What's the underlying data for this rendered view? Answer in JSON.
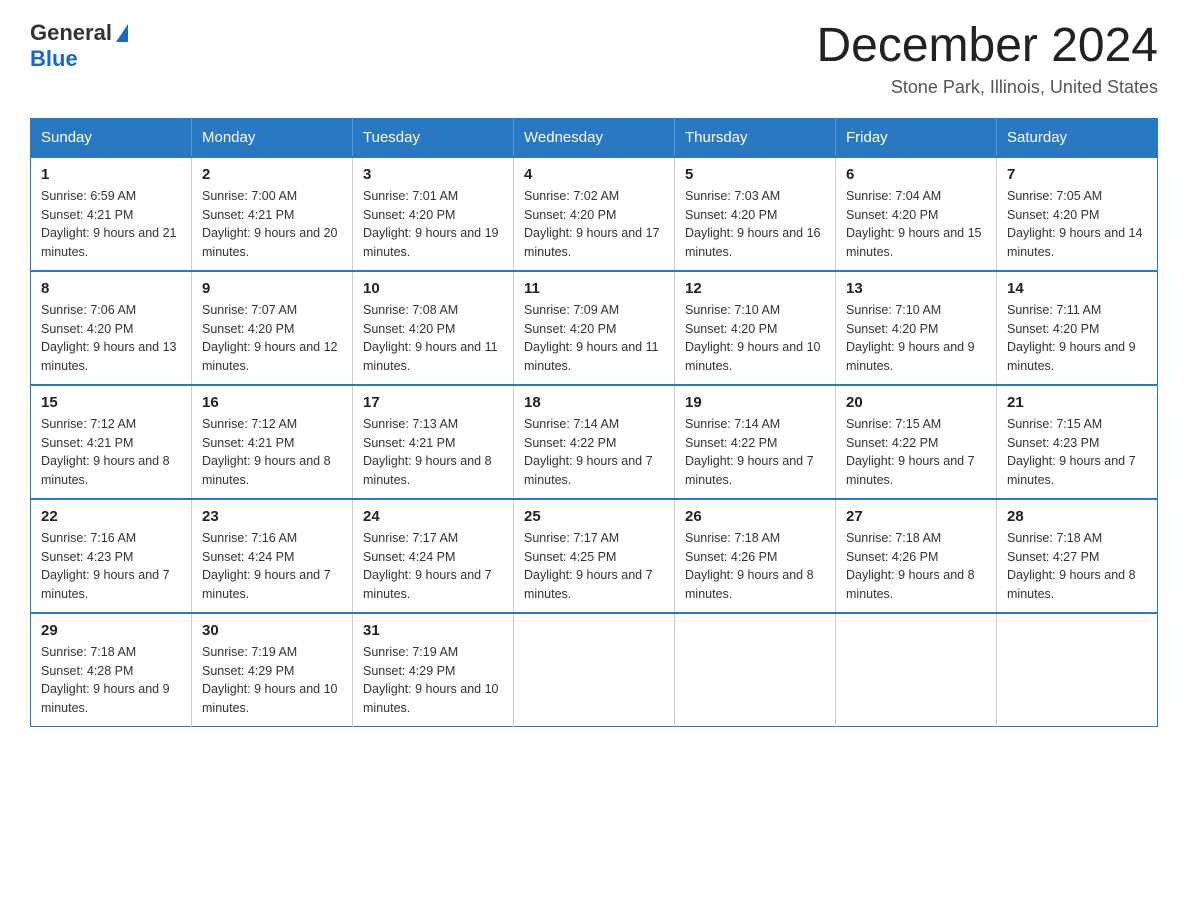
{
  "header": {
    "logo_general": "General",
    "logo_blue": "Blue",
    "month_title": "December 2024",
    "location": "Stone Park, Illinois, United States"
  },
  "days_of_week": [
    "Sunday",
    "Monday",
    "Tuesday",
    "Wednesday",
    "Thursday",
    "Friday",
    "Saturday"
  ],
  "weeks": [
    [
      {
        "day": "1",
        "sunrise": "6:59 AM",
        "sunset": "4:21 PM",
        "daylight": "9 hours and 21 minutes."
      },
      {
        "day": "2",
        "sunrise": "7:00 AM",
        "sunset": "4:21 PM",
        "daylight": "9 hours and 20 minutes."
      },
      {
        "day": "3",
        "sunrise": "7:01 AM",
        "sunset": "4:20 PM",
        "daylight": "9 hours and 19 minutes."
      },
      {
        "day": "4",
        "sunrise": "7:02 AM",
        "sunset": "4:20 PM",
        "daylight": "9 hours and 17 minutes."
      },
      {
        "day": "5",
        "sunrise": "7:03 AM",
        "sunset": "4:20 PM",
        "daylight": "9 hours and 16 minutes."
      },
      {
        "day": "6",
        "sunrise": "7:04 AM",
        "sunset": "4:20 PM",
        "daylight": "9 hours and 15 minutes."
      },
      {
        "day": "7",
        "sunrise": "7:05 AM",
        "sunset": "4:20 PM",
        "daylight": "9 hours and 14 minutes."
      }
    ],
    [
      {
        "day": "8",
        "sunrise": "7:06 AM",
        "sunset": "4:20 PM",
        "daylight": "9 hours and 13 minutes."
      },
      {
        "day": "9",
        "sunrise": "7:07 AM",
        "sunset": "4:20 PM",
        "daylight": "9 hours and 12 minutes."
      },
      {
        "day": "10",
        "sunrise": "7:08 AM",
        "sunset": "4:20 PM",
        "daylight": "9 hours and 11 minutes."
      },
      {
        "day": "11",
        "sunrise": "7:09 AM",
        "sunset": "4:20 PM",
        "daylight": "9 hours and 11 minutes."
      },
      {
        "day": "12",
        "sunrise": "7:10 AM",
        "sunset": "4:20 PM",
        "daylight": "9 hours and 10 minutes."
      },
      {
        "day": "13",
        "sunrise": "7:10 AM",
        "sunset": "4:20 PM",
        "daylight": "9 hours and 9 minutes."
      },
      {
        "day": "14",
        "sunrise": "7:11 AM",
        "sunset": "4:20 PM",
        "daylight": "9 hours and 9 minutes."
      }
    ],
    [
      {
        "day": "15",
        "sunrise": "7:12 AM",
        "sunset": "4:21 PM",
        "daylight": "9 hours and 8 minutes."
      },
      {
        "day": "16",
        "sunrise": "7:12 AM",
        "sunset": "4:21 PM",
        "daylight": "9 hours and 8 minutes."
      },
      {
        "day": "17",
        "sunrise": "7:13 AM",
        "sunset": "4:21 PM",
        "daylight": "9 hours and 8 minutes."
      },
      {
        "day": "18",
        "sunrise": "7:14 AM",
        "sunset": "4:22 PM",
        "daylight": "9 hours and 7 minutes."
      },
      {
        "day": "19",
        "sunrise": "7:14 AM",
        "sunset": "4:22 PM",
        "daylight": "9 hours and 7 minutes."
      },
      {
        "day": "20",
        "sunrise": "7:15 AM",
        "sunset": "4:22 PM",
        "daylight": "9 hours and 7 minutes."
      },
      {
        "day": "21",
        "sunrise": "7:15 AM",
        "sunset": "4:23 PM",
        "daylight": "9 hours and 7 minutes."
      }
    ],
    [
      {
        "day": "22",
        "sunrise": "7:16 AM",
        "sunset": "4:23 PM",
        "daylight": "9 hours and 7 minutes."
      },
      {
        "day": "23",
        "sunrise": "7:16 AM",
        "sunset": "4:24 PM",
        "daylight": "9 hours and 7 minutes."
      },
      {
        "day": "24",
        "sunrise": "7:17 AM",
        "sunset": "4:24 PM",
        "daylight": "9 hours and 7 minutes."
      },
      {
        "day": "25",
        "sunrise": "7:17 AM",
        "sunset": "4:25 PM",
        "daylight": "9 hours and 7 minutes."
      },
      {
        "day": "26",
        "sunrise": "7:18 AM",
        "sunset": "4:26 PM",
        "daylight": "9 hours and 8 minutes."
      },
      {
        "day": "27",
        "sunrise": "7:18 AM",
        "sunset": "4:26 PM",
        "daylight": "9 hours and 8 minutes."
      },
      {
        "day": "28",
        "sunrise": "7:18 AM",
        "sunset": "4:27 PM",
        "daylight": "9 hours and 8 minutes."
      }
    ],
    [
      {
        "day": "29",
        "sunrise": "7:18 AM",
        "sunset": "4:28 PM",
        "daylight": "9 hours and 9 minutes."
      },
      {
        "day": "30",
        "sunrise": "7:19 AM",
        "sunset": "4:29 PM",
        "daylight": "9 hours and 10 minutes."
      },
      {
        "day": "31",
        "sunrise": "7:19 AM",
        "sunset": "4:29 PM",
        "daylight": "9 hours and 10 minutes."
      },
      null,
      null,
      null,
      null
    ]
  ]
}
